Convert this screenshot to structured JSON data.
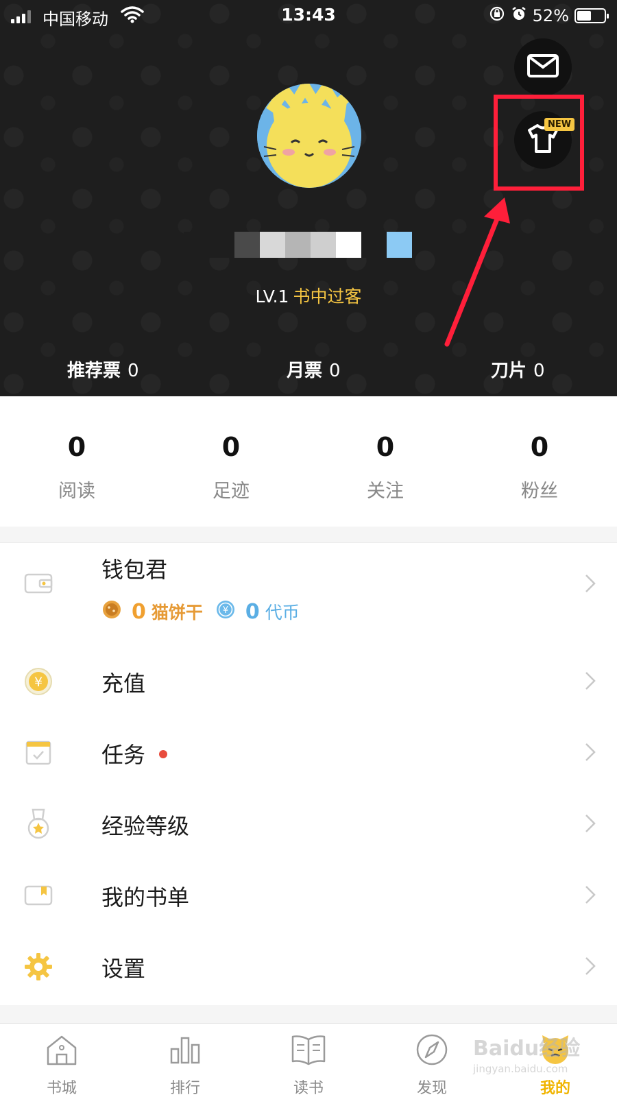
{
  "status_bar": {
    "carrier": "中国移动",
    "time": "13:43",
    "battery_percent": "52%",
    "battery_level": 0.52
  },
  "header": {
    "new_badge": "NEW",
    "level": "LV.1",
    "level_title": "书中过客",
    "tickets": [
      {
        "label": "推荐票",
        "value": "0"
      },
      {
        "label": "月票",
        "value": "0"
      },
      {
        "label": "刀片",
        "value": "0"
      }
    ]
  },
  "stats": [
    {
      "value": "0",
      "label": "阅读"
    },
    {
      "value": "0",
      "label": "足迹"
    },
    {
      "value": "0",
      "label": "关注"
    },
    {
      "value": "0",
      "label": "粉丝"
    }
  ],
  "menu": {
    "wallet": {
      "label": "钱包君",
      "cookie_value": "0",
      "cookie_label": "猫饼干",
      "coin_value": "0",
      "coin_label": "代币"
    },
    "items": [
      {
        "label": "充值",
        "icon": "yen-coin-icon"
      },
      {
        "label": "任务",
        "icon": "calendar-check-icon"
      },
      {
        "label": "经验等级",
        "icon": "medal-icon"
      },
      {
        "label": "我的书单",
        "icon": "booklist-icon"
      },
      {
        "label": "设置",
        "icon": "gear-icon"
      }
    ]
  },
  "tabbar": {
    "tabs": [
      {
        "label": "书城",
        "icon": "house-icon"
      },
      {
        "label": "排行",
        "icon": "bar-chart-icon"
      },
      {
        "label": "读书",
        "icon": "book-icon"
      },
      {
        "label": "发现",
        "icon": "compass-icon"
      },
      {
        "label": "我的",
        "icon": "cat-face-icon"
      }
    ],
    "active_index": 4
  },
  "watermark": {
    "brand": "Baidu经验",
    "url": "jingyan.baidu.com"
  },
  "colors": {
    "header_bg": "#1e1e1e",
    "accent_gold": "#f5c542",
    "highlight_red": "#ff1f3a",
    "cookie_orange": "#f0a030",
    "coin_blue": "#5aaee4",
    "task_dot": "#e84c3d"
  }
}
